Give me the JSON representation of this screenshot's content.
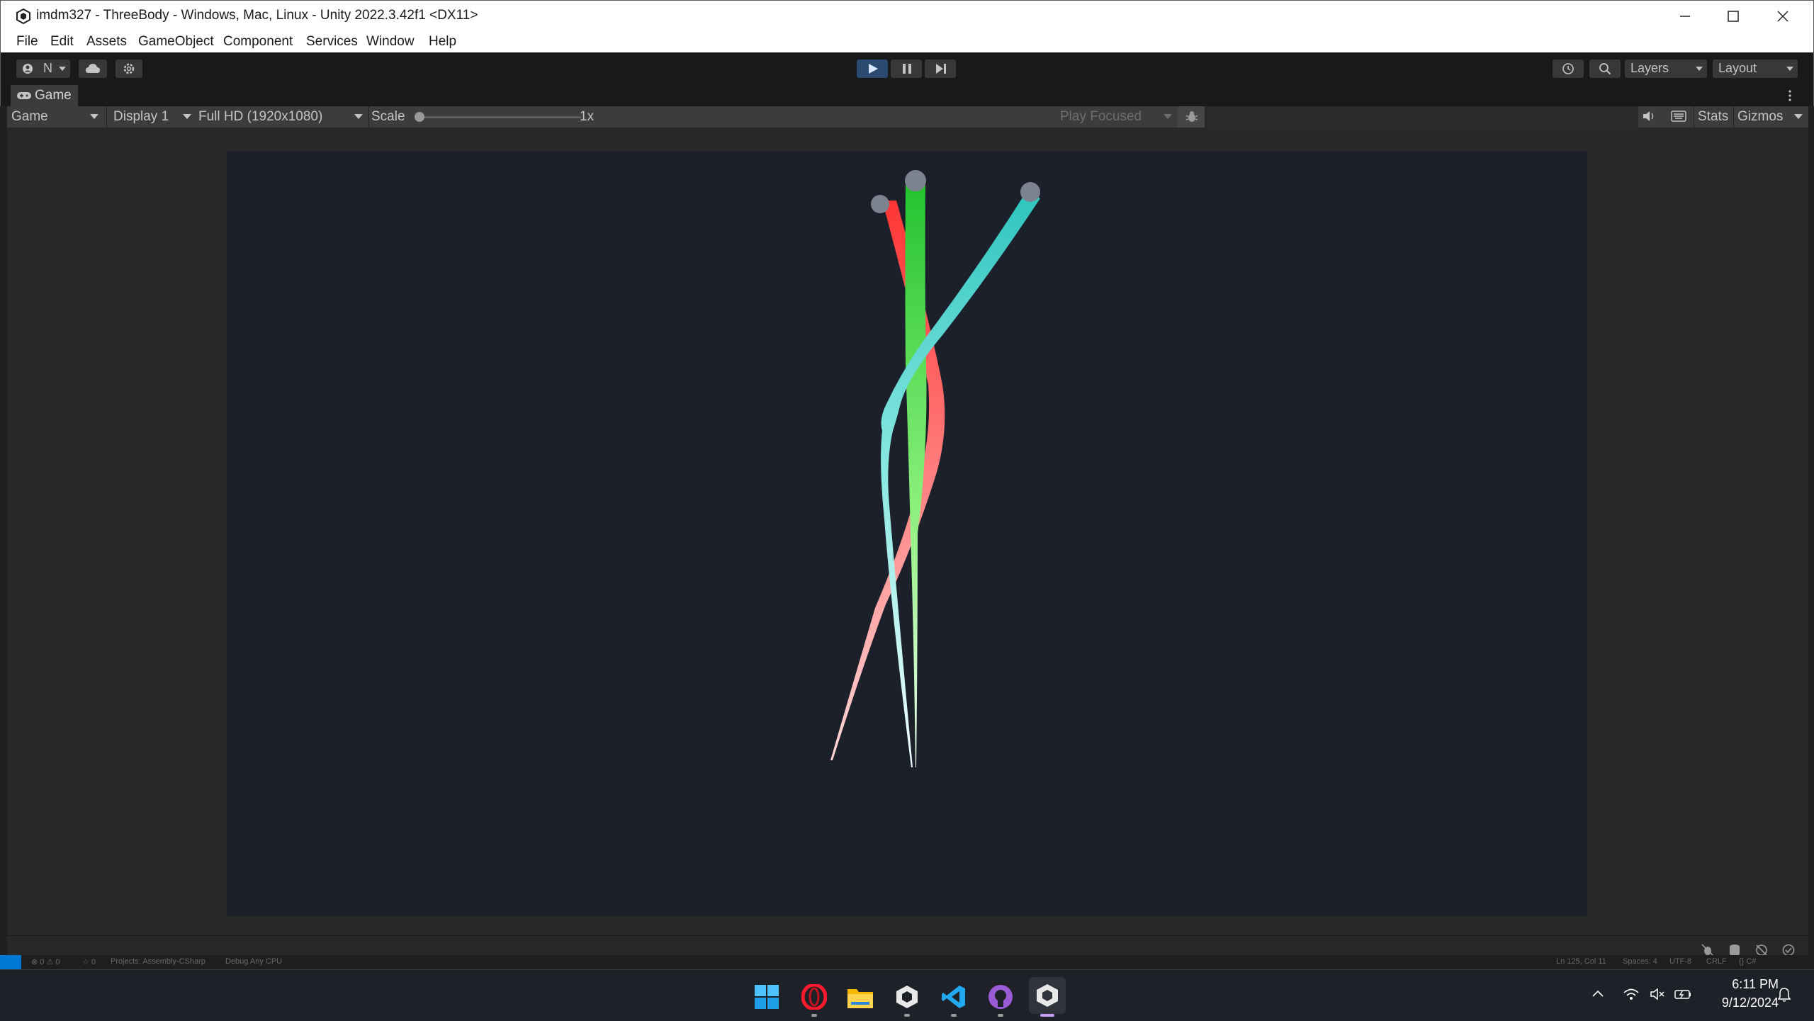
{
  "window": {
    "title": "imdm327 - ThreeBody - Windows, Mac, Linux - Unity 2022.3.42f1 <DX11>"
  },
  "menu": [
    "File",
    "Edit",
    "Assets",
    "GameObject",
    "Component",
    "Services",
    "Window",
    "Help"
  ],
  "toolbar": {
    "account_label": "N",
    "search_tooltip": "search-icon",
    "layers_label": "Layers",
    "layout_label": "Layout"
  },
  "tab": {
    "label": "Game"
  },
  "gamebar": {
    "view_select": "Game",
    "display_select": "Display 1",
    "resolution_select": "Full HD (1920x1080)",
    "scale_label": "Scale",
    "scale_value": "1x",
    "scale_level": 0.0,
    "play_mode_select": "Play Focused",
    "stats_label": "Stats",
    "gizmos_label": "Gizmos"
  },
  "bodies": [
    {
      "name": "red",
      "color": "#ff3b3b"
    },
    {
      "name": "green",
      "color": "#29c43a"
    },
    {
      "name": "cyan",
      "color": "#35c8c2"
    }
  ],
  "statusbar": {
    "left": [
      "⊗ 0  ⚠ 0",
      "☆ 0",
      "Projects: Assembly-CSharp",
      "Debug Any CPU"
    ],
    "right": [
      "Ln 125, Col 11",
      "Spaces: 4",
      "UTF-8",
      "CRLF",
      "{} C#"
    ]
  },
  "taskbar": {
    "time": "6:11 PM",
    "date": "9/12/2024",
    "apps": [
      "start-icon",
      "opera-icon",
      "file-explorer-icon",
      "unity-hub-icon",
      "vscode-icon",
      "github-desktop-icon",
      "unity-editor-icon"
    ]
  }
}
